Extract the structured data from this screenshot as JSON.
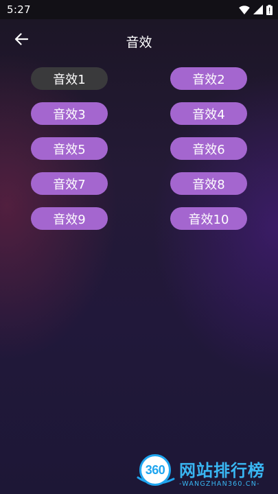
{
  "status_bar": {
    "time": "5:27",
    "icons": [
      "wifi-icon",
      "signal-icon",
      "battery-icon"
    ]
  },
  "header": {
    "title": "音效"
  },
  "effects": [
    {
      "label": "音效1",
      "selected": true
    },
    {
      "label": "音效2",
      "selected": false
    },
    {
      "label": "音效3",
      "selected": false
    },
    {
      "label": "音效4",
      "selected": false
    },
    {
      "label": "音效5",
      "selected": false
    },
    {
      "label": "音效6",
      "selected": false
    },
    {
      "label": "音效7",
      "selected": false
    },
    {
      "label": "音效8",
      "selected": false
    },
    {
      "label": "音效9",
      "selected": false
    },
    {
      "label": "音效10",
      "selected": false
    }
  ],
  "colors": {
    "button": "#a466cf",
    "button_selected": "#3a3a3c",
    "watermark": "#39b6f2"
  },
  "watermark": {
    "logo_text": "360",
    "name": "网站排行榜",
    "subtitle": "-WANGZHAN360.CN-"
  }
}
